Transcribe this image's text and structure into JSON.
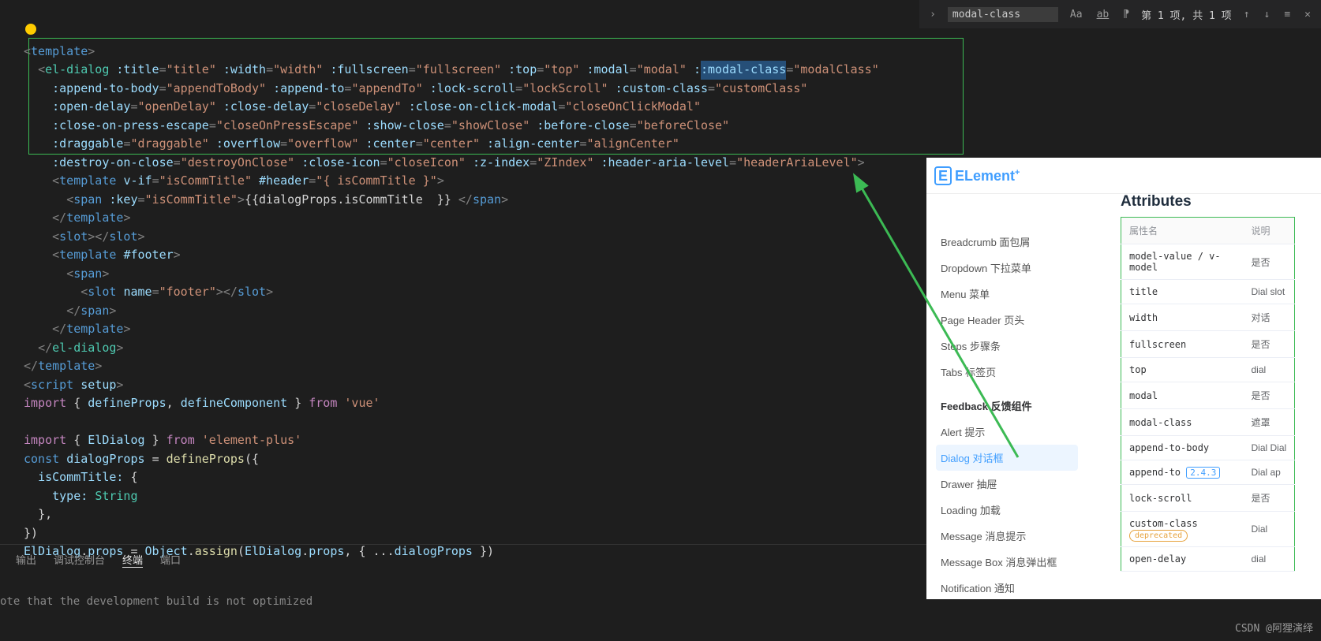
{
  "find": {
    "input": "modal-class",
    "result": "第 1 项, 共 1 项",
    "icons": [
      "Aa",
      "ab",
      "⁋"
    ],
    "nav": [
      "↑",
      "↓",
      "≡",
      "✕"
    ]
  },
  "code": {
    "l1": {
      "tag": "template"
    },
    "l2": {
      "comp": "el-dialog",
      "a1": ":title",
      "v1": "title",
      "a2": ":width",
      "v2": "width",
      "a3": ":fullscreen",
      "v3": "fullscreen",
      "a4": ":top",
      "v4": "top",
      "a5": ":modal",
      "v5": "modal",
      "a6": ":modal-class",
      "v6": "modalClass"
    },
    "l3": {
      "a1": ":append-to-body",
      "v1": "appendToBody",
      "a2": ":append-to",
      "v2": "appendTo",
      "a3": ":lock-scroll",
      "v3": "lockScroll",
      "a4": ":custom-class",
      "v4": "customClass"
    },
    "l4": {
      "a1": ":open-delay",
      "v1": "openDelay",
      "a2": ":close-delay",
      "v2": "closeDelay",
      "a3": ":close-on-click-modal",
      "v3": "closeOnClickModal"
    },
    "l5": {
      "a1": ":close-on-press-escape",
      "v1": "closeOnPressEscape",
      "a2": ":show-close",
      "v2": "showClose",
      "a3": ":before-close",
      "v3": "beforeClose"
    },
    "l6": {
      "a1": ":draggable",
      "v1": "draggable",
      "a2": ":overflow",
      "v2": "overflow",
      "a3": ":center",
      "v3": "center",
      "a4": ":align-center",
      "v4": "alignCenter"
    },
    "l7": {
      "a1": ":destroy-on-close",
      "v1": "destroyOnClose",
      "a2": ":close-icon",
      "v2": "closeIcon",
      "a3": ":z-index",
      "v3": "ZIndex",
      "a4": ":header-aria-level",
      "v4": "headerAriaLevel"
    },
    "l8": {
      "tag": "template",
      "a1": "v-if",
      "v1": "isCommTitle",
      "a2": "#header",
      "v2": "{ isCommTitle }"
    },
    "l9": {
      "tag": "span",
      "a1": ":key",
      "v1": "isCommTitle",
      "expr": "{{dialogProps.isCommTitle  }}",
      "close": "span"
    },
    "l10": "template",
    "l11": "slot",
    "l12": {
      "tag": "template",
      "a": "#footer"
    },
    "l13": "span",
    "l14": {
      "tag": "slot",
      "a": "name",
      "v": "footer",
      "close": "slot"
    },
    "l15": "span",
    "l16": "template",
    "l17": "el-dialog",
    "l18": "template",
    "l19": {
      "tag": "script",
      "a": "setup"
    },
    "l20": {
      "kw": "import",
      "c1": "defineProps",
      "c2": "defineComponent",
      "kw2": "from",
      "s": "'vue'"
    },
    "l22": {
      "kw": "import",
      "c": "ElDialog",
      "kw2": "from",
      "s": "'element-plus'"
    },
    "l23": {
      "kw": "const",
      "v": "dialogProps",
      "f": "defineProps"
    },
    "l24": "isCommTitle:",
    "l25a": "type:",
    "l25b": "String",
    "l28": {
      "o": "ElDialog",
      "p": "props",
      "m": "Object",
      "f": "assign",
      "a": "ElDialog",
      "ap": "props",
      "v": "dialogProps"
    }
  },
  "tabs": [
    "输出",
    "调试控制台",
    "终端",
    "端口"
  ],
  "termline": "ote that the development build is not optimized",
  "doc": {
    "brand": "ELement",
    "plus": "+",
    "nav": [
      "Breadcrumb 面包屑",
      "Dropdown 下拉菜单",
      "Menu 菜单",
      "Page Header 页头",
      "Steps 步骤条",
      "Tabs 标签页"
    ],
    "sec": "Feedback 反馈组件",
    "nav2": [
      "Alert 提示",
      "Dialog 对话框",
      "Drawer 抽屉",
      "Loading 加载",
      "Message 消息提示",
      "Message Box 消息弹出框",
      "Notification 通知"
    ],
    "active": "Dialog 对话框",
    "heading": "Attributes",
    "th1": "属性名",
    "th2": "说明",
    "rows": [
      {
        "n": "model-value / v-model",
        "d": "是否"
      },
      {
        "n": "title",
        "d": "Dial slot"
      },
      {
        "n": "width",
        "d": "对话"
      },
      {
        "n": "fullscreen",
        "d": "是否"
      },
      {
        "n": "top",
        "d": "dial"
      },
      {
        "n": "modal",
        "d": "是否"
      },
      {
        "n": "modal-class",
        "d": "遮罩"
      },
      {
        "n": "append-to-body",
        "d": "Dial Dial"
      },
      {
        "n": "append-to",
        "badge": "2.4.3",
        "d": "Dial ap"
      },
      {
        "n": "lock-scroll",
        "d": "是否"
      },
      {
        "n": "custom-class",
        "dep": "deprecated",
        "d": "Dial"
      },
      {
        "n": "open-delay",
        "d": "dial"
      }
    ]
  },
  "watermark": "CSDN @阿狸演绎"
}
